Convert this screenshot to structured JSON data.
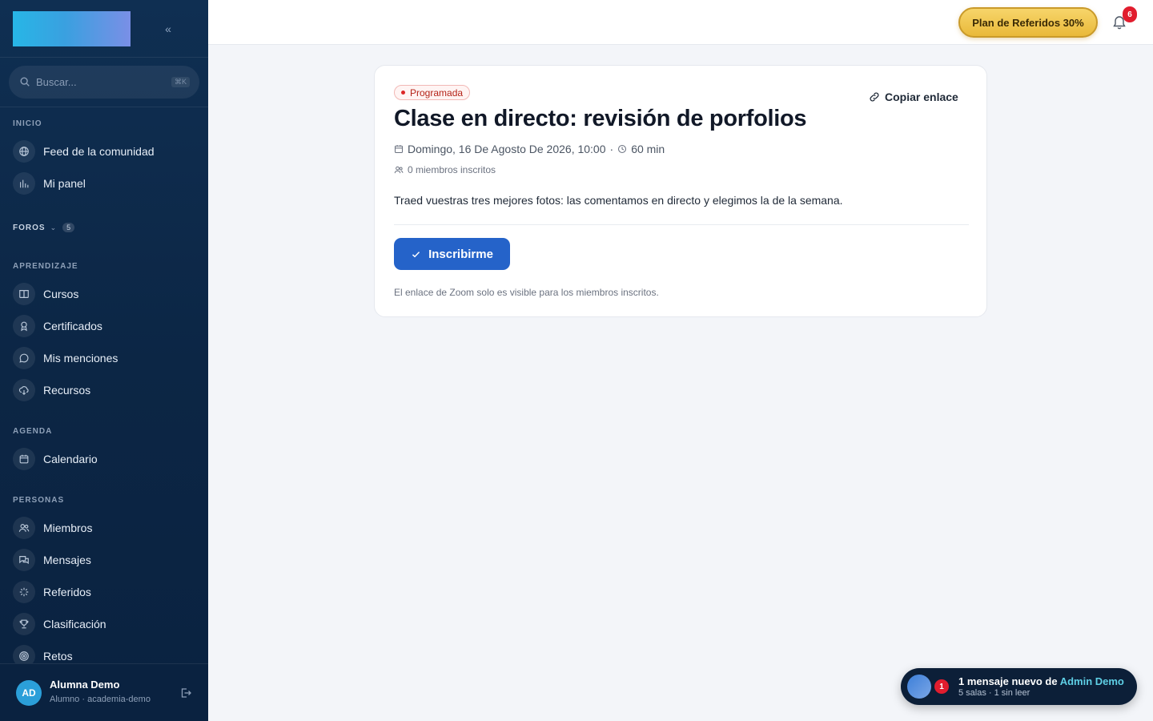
{
  "sidebar": {
    "collapse_glyph": "«",
    "search": {
      "placeholder": "Buscar...",
      "shortcut": "⌘K"
    },
    "sections": {
      "inicio": "INICIO",
      "foros": "FOROS",
      "foros_count": "5",
      "aprendizaje": "APRENDIZAJE",
      "agenda": "AGENDA",
      "personas": "PERSONAS"
    },
    "items": {
      "feed": "Feed de la comunidad",
      "panel": "Mi panel",
      "cursos": "Cursos",
      "certificados": "Certificados",
      "menciones": "Mis menciones",
      "recursos": "Recursos",
      "calendario": "Calendario",
      "miembros": "Miembros",
      "mensajes": "Mensajes",
      "referidos": "Referidos",
      "clasificacion": "Clasificación",
      "retos": "Retos"
    },
    "user": {
      "initials": "AD",
      "name": "Alumna Demo",
      "role": "Alumno · academia-demo"
    }
  },
  "topbar": {
    "referral_label": "Plan de Referidos 30%",
    "notifications_count": "6"
  },
  "event": {
    "status": "Programada",
    "title": "Clase en directo: revisión de porfolios",
    "copy_link": "Copiar enlace",
    "date": "Domingo, 16 De Agosto De 2026, 10:00",
    "separator": "·",
    "duration": "60 min",
    "members": "0 miembros inscritos",
    "description": "Traed vuestras tres mejores fotos: las comentamos en directo y elegimos la de la semana.",
    "enroll_label": "Inscribirme",
    "note": "El enlace de Zoom solo es visible para los miembros inscritos."
  },
  "toast": {
    "badge": "1",
    "prefix": "1 mensaje nuevo de",
    "sender": "Admin Demo",
    "subtitle": "5 salas · 1 sin leer"
  },
  "colors": {
    "sidebar_bg": "#0c2645",
    "primary_button": "#2563c9",
    "status_red": "#dc2626",
    "referral_gold": "#e9b93a",
    "badge_red": "#e11d2e",
    "highlight_cyan": "#5fd0e6"
  }
}
